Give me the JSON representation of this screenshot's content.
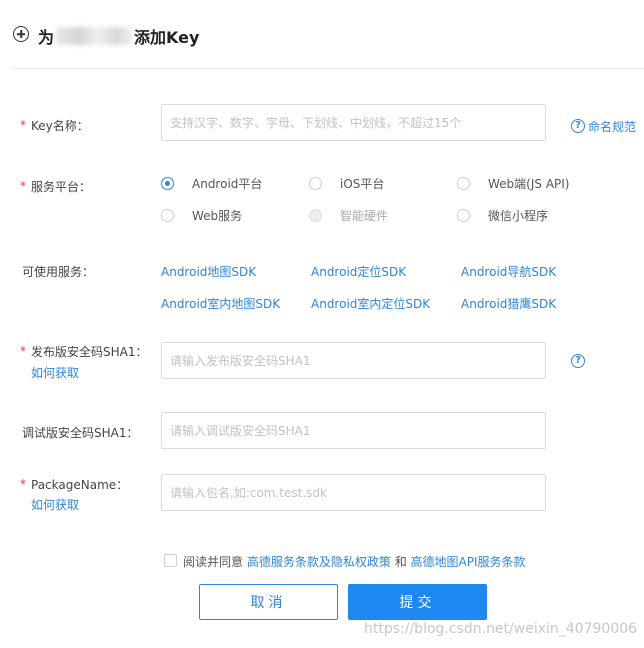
{
  "header": {
    "title_prefix": "为",
    "title_suffix": "添加Key"
  },
  "form": {
    "key_name": {
      "label": "Key名称：",
      "placeholder": "支持汉字、数字、字母、下划线、中划线，不超过15个",
      "help_link": "命名规范"
    },
    "platform": {
      "label": "服务平台：",
      "options": [
        {
          "label": "Android平台",
          "state": "checked"
        },
        {
          "label": "iOS平台",
          "state": "normal"
        },
        {
          "label": "Web端(JS API)",
          "state": "normal"
        },
        {
          "label": "Web服务",
          "state": "normal"
        },
        {
          "label": "智能硬件",
          "state": "disabled"
        },
        {
          "label": "微信小程序",
          "state": "normal"
        }
      ]
    },
    "services": {
      "label": "可使用服务：",
      "items": [
        "Android地图SDK",
        "Android定位SDK",
        "Android导航SDK",
        "Android室内地图SDK",
        "Android室内定位SDK",
        "Android猎鹰SDK"
      ]
    },
    "release_sha1": {
      "label": "发布版安全码SHA1：",
      "how_link": "如何获取",
      "placeholder": "请输入发布版安全码SHA1"
    },
    "debug_sha1": {
      "label": "调试版安全码SHA1：",
      "placeholder": "请输入调试版安全码SHA1"
    },
    "package_name": {
      "label": "PackageName：",
      "how_link": "如何获取",
      "placeholder": "请输入包名,如:com.test.sdk"
    },
    "agreement": {
      "prefix": "阅读并同意",
      "link1": "高德服务条款及隐私权政策",
      "and": "和",
      "link2": "高德地图API服务条款"
    },
    "buttons": {
      "cancel": "取消",
      "submit": "提交"
    }
  },
  "watermark": "https://blog.csdn.net/weixin_40790006",
  "colors": {
    "accent": "#2f86d6",
    "submit": "#1e88f0",
    "required": "#e4393c"
  }
}
